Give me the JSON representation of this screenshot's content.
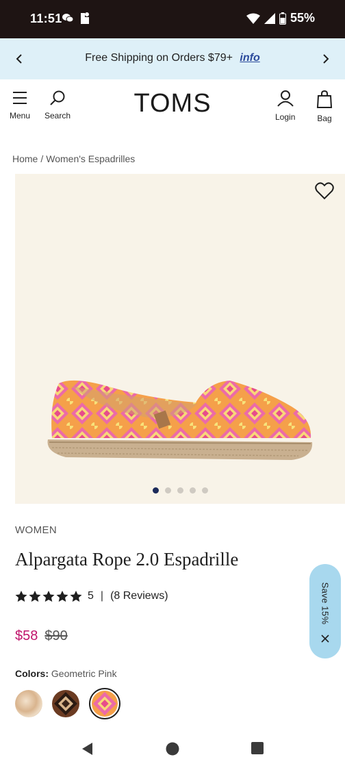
{
  "status_bar": {
    "time": "11:51",
    "battery": "55%"
  },
  "promo": {
    "text": "Free Shipping on Orders $79+",
    "link": "info"
  },
  "header": {
    "logo": "TOMS",
    "menu_label": "Menu",
    "search_label": "Search",
    "login_label": "Login",
    "bag_label": "Bag"
  },
  "breadcrumb": {
    "home": "Home",
    "separator": "/",
    "current": "Women's Espadrilles"
  },
  "product": {
    "category": "WOMEN",
    "title": "Alpargata Rope 2.0 Espadrille",
    "rating": 5,
    "rating_text": "5",
    "rating_separator": "|",
    "reviews_text": "(8 Reviews)",
    "price_sale": "$58",
    "price_original": "$90",
    "colors_label": "Colors:",
    "color_selected": "Geometric Pink",
    "image_count": 5,
    "active_image": 1
  },
  "swatches": [
    {
      "name": "tan-swatch",
      "selected": false
    },
    {
      "name": "brown-geometric-swatch",
      "selected": false
    },
    {
      "name": "geometric-pink-swatch",
      "selected": true
    }
  ],
  "save_pill": {
    "text": "Save 15%"
  },
  "colors": {
    "accent_sale": "#c0136b",
    "promo_bg": "#def0f8",
    "save_pill_bg": "#a8d8ee",
    "status_bar_bg": "#1e1413",
    "dot_active": "#1c2a5a"
  }
}
